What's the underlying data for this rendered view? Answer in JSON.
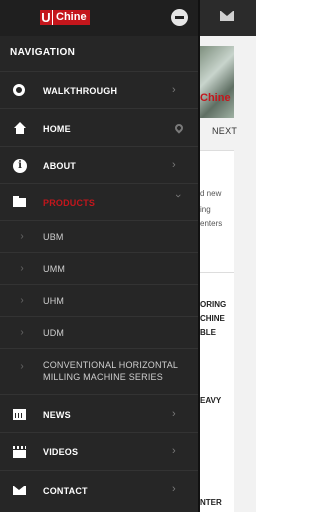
{
  "header": {
    "logo_u": "U",
    "logo_text": "Chine"
  },
  "background": {
    "next_label": "NEXT",
    "banner_text": "Chine",
    "snippets": [
      "d new",
      "ing",
      "enters",
      "ORING",
      "CHINE",
      "BLE",
      "EAVY",
      "NTER"
    ]
  },
  "nav": {
    "title": "NAVIGATION",
    "items": [
      {
        "label": "WALKTHROUGH",
        "icon": "lifering-icon"
      },
      {
        "label": "HOME",
        "icon": "home-icon"
      },
      {
        "label": "ABOUT",
        "icon": "info-icon"
      },
      {
        "label": "PRODUCTS",
        "icon": "folder-icon",
        "active": true
      },
      {
        "label": "UBM"
      },
      {
        "label": "UMM"
      },
      {
        "label": "UHM"
      },
      {
        "label": "UDM"
      },
      {
        "label": "CONVENTIONAL HORIZONTAL MILLING MACHINE SERIES"
      },
      {
        "label": "NEWS",
        "icon": "calendar-icon"
      },
      {
        "label": "VIDEOS",
        "icon": "video-icon"
      },
      {
        "label": "CONTACT",
        "icon": "envelope-icon"
      }
    ]
  },
  "colors": {
    "accent": "#c4161c",
    "drawer_bg": "#262626"
  }
}
